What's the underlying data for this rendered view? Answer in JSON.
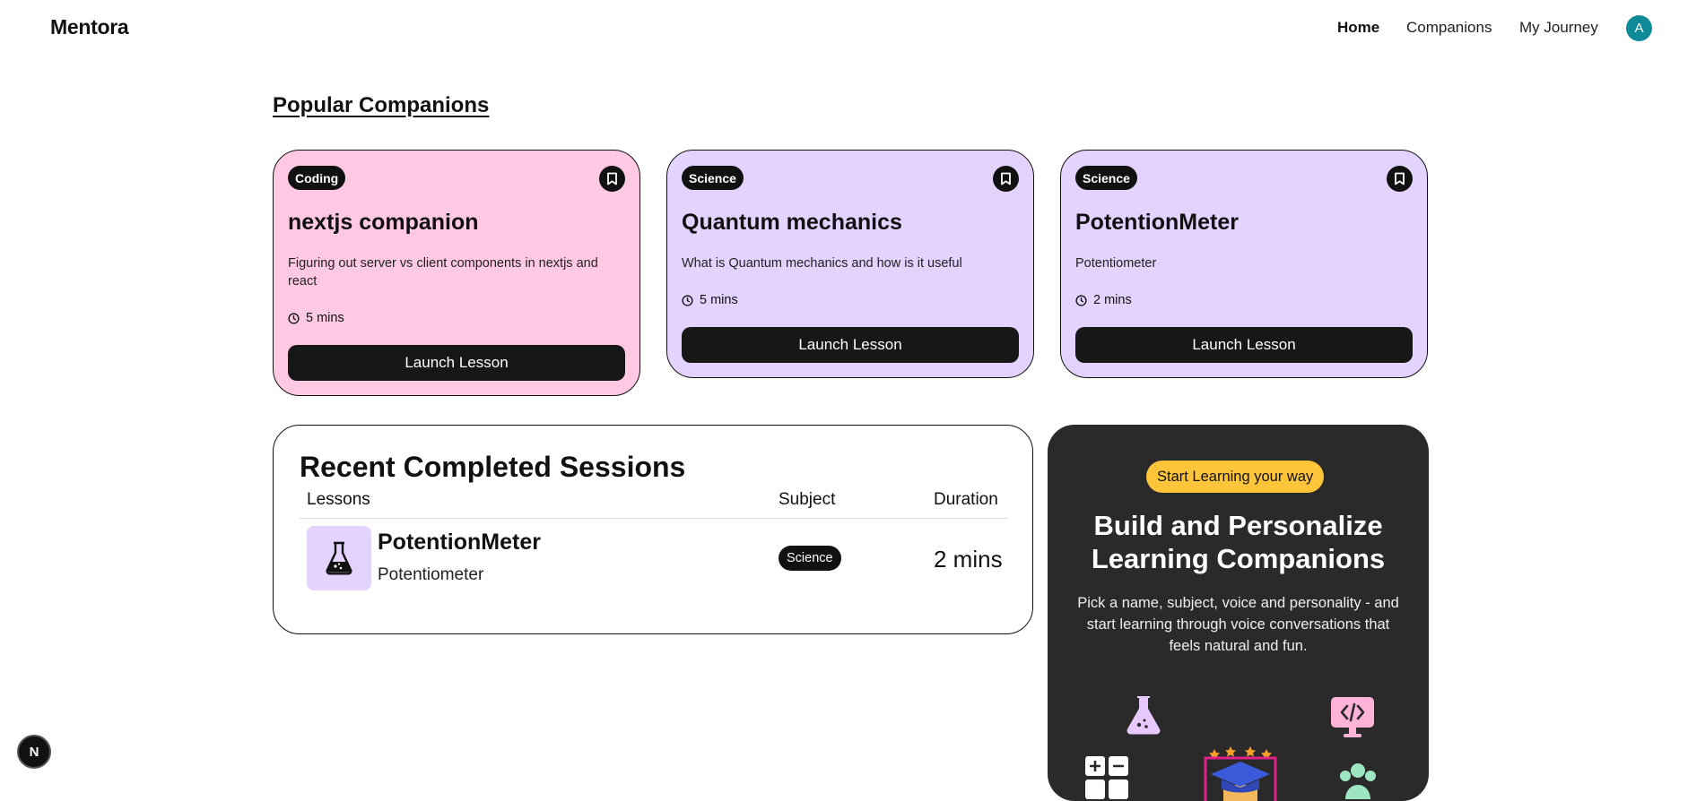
{
  "nav": {
    "logo": "Mentora",
    "links": [
      {
        "label": "Home",
        "active": true
      },
      {
        "label": "Companions",
        "active": false
      },
      {
        "label": "My Journey",
        "active": false
      }
    ],
    "avatar_initial": "A"
  },
  "popular": {
    "title": "Popular Companions",
    "cards": [
      {
        "subject": "Coding",
        "title": "nextjs companion",
        "description": "Figuring out server vs client components in nextjs and react",
        "duration": "5 mins",
        "button": "Launch Lesson",
        "bg_color": "#ffc8e3"
      },
      {
        "subject": "Science",
        "title": "Quantum mechanics",
        "description": "What is Quantum mechanics and how is it useful",
        "duration": "5 mins",
        "button": "Launch Lesson",
        "bg_color": "#e4d3ff"
      },
      {
        "subject": "Science",
        "title": "PotentionMeter",
        "description": "Potentiometer",
        "duration": "2 mins",
        "button": "Launch Lesson",
        "bg_color": "#e4d3ff"
      }
    ]
  },
  "recent": {
    "title": "Recent Completed Sessions",
    "headers": {
      "lessons": "Lessons",
      "subject": "Subject",
      "duration": "Duration"
    },
    "rows": [
      {
        "title": "PotentionMeter",
        "subtitle": "Potentiometer",
        "subject": "Science",
        "duration": "2 mins",
        "icon": "flask-icon"
      }
    ]
  },
  "cta": {
    "pill": "Start Learning your way",
    "title": "Build and Personalize Learning Companions",
    "description": "Pick a name, subject, voice and personality - and start learning through voice conversations that feels natural and fun."
  },
  "next_indicator": "N",
  "colors": {
    "accent_yellow": "#fec53a",
    "avatar": "#0f8a99",
    "card_dark": "#2a2a2a"
  }
}
